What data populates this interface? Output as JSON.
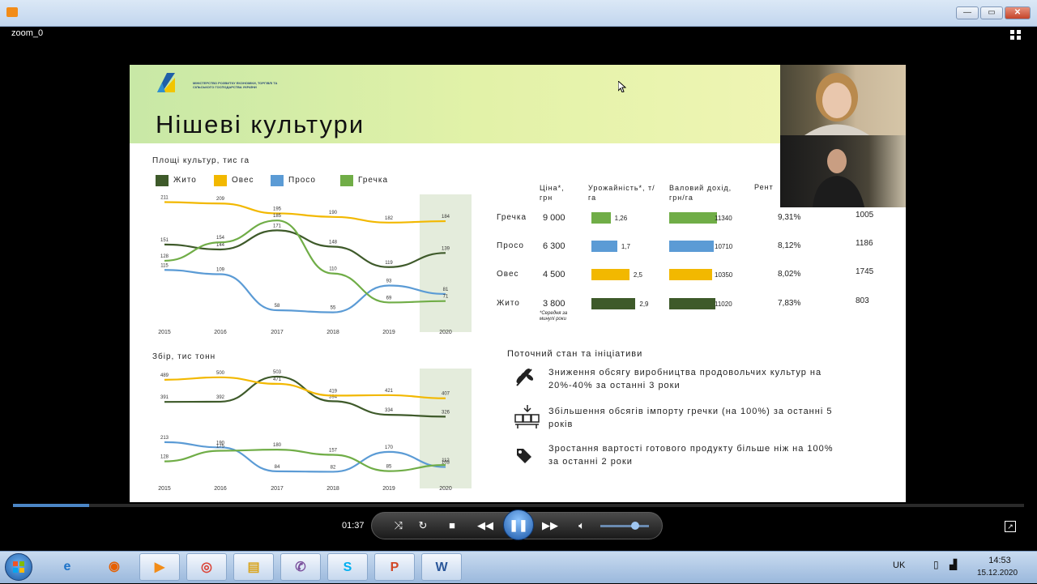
{
  "window": {
    "minimize": "—",
    "restore": "▭",
    "close": "✕"
  },
  "player": {
    "window_label": "zoom_0",
    "time": "01:37",
    "progress": 0.075,
    "volume": 0.72
  },
  "slide": {
    "title": "Нішеві культури",
    "logo_text": "МІНІСТЕРСТВО РОЗВИТКУ ЕКОНОМІКИ, ТОРГІВЛІ ТА СІЛЬСЬКОГО ГОСПОДАРСТВА УКРАЇНИ",
    "legend": [
      {
        "label": "Жито",
        "color": "#3e5a2a"
      },
      {
        "label": "Овес",
        "color": "#f2b800"
      },
      {
        "label": "Просо",
        "color": "#5b9bd5"
      },
      {
        "label": "Гречка",
        "color": "#70ad47"
      }
    ],
    "chart1_title": "Площі культур, тис га",
    "chart2_title": "Збір, тис тонн",
    "table": {
      "headers": [
        "Ціна*, грн",
        "Урожайність*, т/га",
        "Валовий дохід, грн/га",
        "Рент"
      ],
      "footnote": "*Середня за минулі роки",
      "rows": [
        {
          "crop": "Гречка",
          "price": "9 000",
          "yield": "1,26",
          "yield_value": 1.26,
          "income": "11340",
          "income_value": 11340,
          "rent": "9,31%",
          "extra": "1005",
          "color": "#70ad47"
        },
        {
          "crop": "Просо",
          "price": "6 300",
          "yield": "1,7",
          "yield_value": 1.7,
          "income": "10710",
          "income_value": 10710,
          "rent": "8,12%",
          "extra": "1186",
          "color": "#5b9bd5"
        },
        {
          "crop": "Овес",
          "price": "4 500",
          "yield": "2,5",
          "yield_value": 2.5,
          "income": "10350",
          "income_value": 10350,
          "rent": "8,02%",
          "extra": "1745",
          "color": "#f2b800"
        },
        {
          "crop": "Жито",
          "price": "3 800",
          "yield": "2,9",
          "yield_value": 2.9,
          "income": "11020",
          "income_value": 11020,
          "rent": "7,83%",
          "extra": "803",
          "color": "#3e5a2a"
        }
      ]
    },
    "status_title": "Поточний стан та ініціативи",
    "status_items": [
      {
        "icon": "wheat-icon",
        "text1": "Зниження обсягу виробництва продовольчих культур на",
        "text2": "20%-40% за останні 3 роки"
      },
      {
        "icon": "import-icon",
        "text1": "Збільшення обсягів імпорту гречки (на 100%) за останні 5",
        "text2": "років"
      },
      {
        "icon": "price-tag-icon",
        "text1": "Зростання вартості готового продукту більше ніж на 100%",
        "text2": "за останні 2 роки"
      }
    ]
  },
  "chart_data": [
    {
      "type": "line",
      "title": "Площі культур, тис га",
      "x": [
        "2015",
        "2016",
        "2017",
        "2018",
        "2019",
        "2020"
      ],
      "series": [
        {
          "name": "Жито",
          "color": "#3e5a2a",
          "values": [
            151,
            144,
            171,
            148,
            119,
            139
          ]
        },
        {
          "name": "Овес",
          "color": "#f2b800",
          "values": [
            211,
            209,
            195,
            190,
            182,
            184
          ]
        },
        {
          "name": "Просо",
          "color": "#5b9bd5",
          "values": [
            115,
            109,
            58,
            55,
            93,
            81
          ]
        },
        {
          "name": "Гречка",
          "color": "#70ad47",
          "values": [
            128,
            154,
            185,
            110,
            69,
            71
          ]
        }
      ],
      "labels": {
        "Жито": [
          "151",
          "144",
          "171",
          "148",
          "119",
          "139"
        ],
        "Овес": [
          "211",
          "209",
          "195",
          "190",
          "182",
          "184"
        ],
        "Просо": [
          "115",
          "109",
          "58",
          "55",
          "93",
          "81"
        ],
        "Гречка": [
          "128",
          "154",
          "185",
          "110",
          "69",
          "71"
        ]
      }
    },
    {
      "type": "line",
      "title": "Збір, тис тонн",
      "x": [
        "2015",
        "2016",
        "2017",
        "2018",
        "2019",
        "2020"
      ],
      "series": [
        {
          "name": "Жито",
          "color": "#3e5a2a",
          "values": [
            391,
            392,
            503,
            394,
            334,
            326
          ]
        },
        {
          "name": "Овес",
          "color": "#f2b800",
          "values": [
            489,
            500,
            471,
            419,
            421,
            407
          ]
        },
        {
          "name": "Просо",
          "color": "#5b9bd5",
          "values": [
            213,
            190,
            84,
            82,
            170,
            103
          ]
        },
        {
          "name": "Гречка",
          "color": "#70ad47",
          "values": [
            128,
            175,
            180,
            157,
            85,
            112
          ]
        }
      ],
      "labels": {
        "Жито": [
          "391",
          "392",
          "503",
          "394",
          "334",
          "326"
        ],
        "Овес": [
          "489",
          "500",
          "471",
          "419",
          "421",
          "407"
        ],
        "Просо": [
          "213",
          "190",
          "84",
          "82",
          "170",
          "103"
        ],
        "Гречка": [
          "128",
          "175",
          "180",
          "157",
          "85",
          "112"
        ]
      }
    }
  ],
  "taskbar": {
    "items": [
      {
        "name": "ie-icon",
        "glyph": "e",
        "color": "#1e73c8"
      },
      {
        "name": "firefox-icon",
        "glyph": "◉",
        "color": "#e66000"
      },
      {
        "name": "media-player-icon",
        "glyph": "▶",
        "color": "#f28c18"
      },
      {
        "name": "chrome-icon",
        "glyph": "◎",
        "color": "#db4437"
      },
      {
        "name": "folder-icon",
        "glyph": "▤",
        "color": "#d9a520"
      },
      {
        "name": "viber-icon",
        "glyph": "✆",
        "color": "#7b519d"
      },
      {
        "name": "skype-icon",
        "glyph": "S",
        "color": "#00aff0"
      },
      {
        "name": "powerpoint-icon",
        "glyph": "P",
        "color": "#d24726"
      },
      {
        "name": "word-icon",
        "glyph": "W",
        "color": "#2b579a"
      }
    ],
    "lang": "UK",
    "time": "14:53",
    "date": "15.12.2020"
  }
}
